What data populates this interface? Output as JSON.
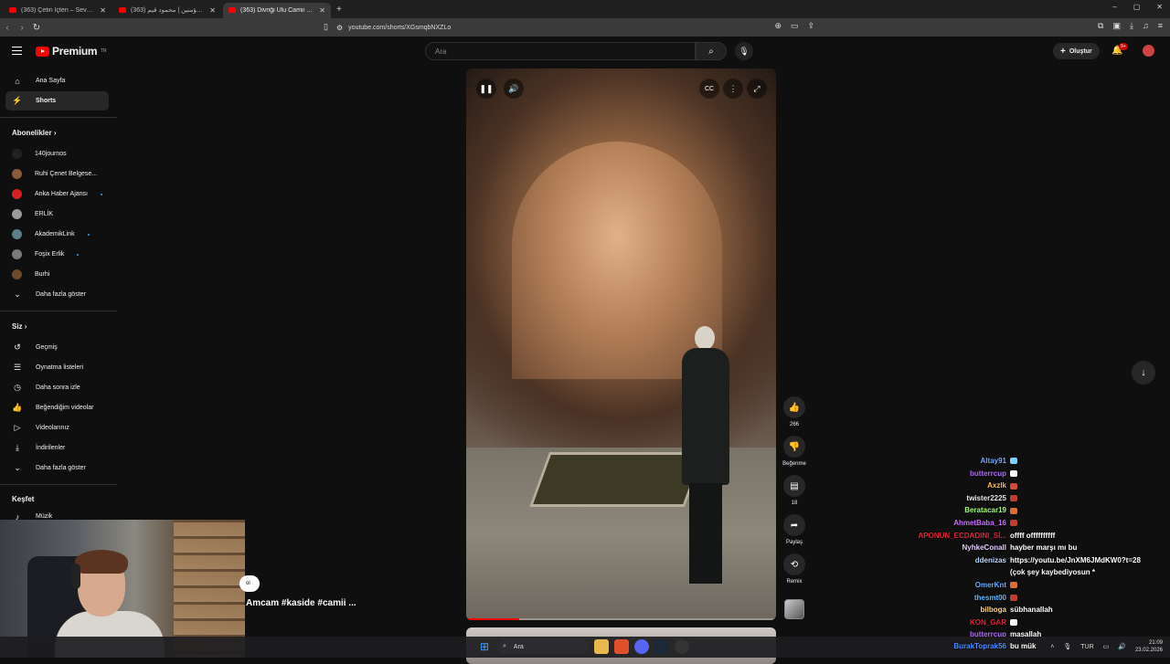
{
  "browser": {
    "tabs": [
      {
        "label": "(363) Çetin İçten – Sevda Değil | Orgi...",
        "active": false
      },
      {
        "label": "ذكر أمير المؤمنين | محمود قيم (363) ...",
        "active": false
      },
      {
        "label": "(363) Divriği Ulu Camii Fehmi...",
        "active": true
      }
    ],
    "new_tab": "+",
    "url": "youtube.com/shorts/XGsmqbNXZLo"
  },
  "youtube": {
    "logo_text": "Premium",
    "logo_sup": "TR",
    "search_placeholder": "Ara",
    "create_label": "Oluştur",
    "notif_badge": "9+"
  },
  "sidebar": {
    "main": [
      {
        "label": "Ana Sayfa",
        "icon": "home-icon",
        "active": false
      },
      {
        "label": "Shorts",
        "icon": "shorts-icon",
        "active": true
      }
    ],
    "subs_heading": "Abonelikler",
    "subs": [
      {
        "label": "140journos",
        "color": "#222222",
        "dot": false
      },
      {
        "label": "Ruhi Çenet Belgese...",
        "color": "#8a5a3a",
        "dot": false
      },
      {
        "label": "Anka Haber Ajansı",
        "color": "#d22222",
        "dot": true
      },
      {
        "label": "ERLİK",
        "color": "#9a9a9a",
        "dot": false
      },
      {
        "label": "AkademikLink",
        "color": "#5d7f8a",
        "dot": true
      },
      {
        "label": "Foşix Erlik",
        "color": "#7a7a7a",
        "dot": true
      },
      {
        "label": "Burhi",
        "color": "#6b4a2a",
        "dot": false
      }
    ],
    "subs_more": "Daha fazla göster",
    "you_heading": "Siz",
    "you": [
      {
        "label": "Geçmiş",
        "icon": "history-icon"
      },
      {
        "label": "Oynatma listeleri",
        "icon": "playlist-icon"
      },
      {
        "label": "Daha sonra izle",
        "icon": "clock-icon"
      },
      {
        "label": "Beğendiğim videolar",
        "icon": "like-icon"
      },
      {
        "label": "Videolarınız",
        "icon": "video-icon"
      },
      {
        "label": "İndirilenler",
        "icon": "download-icon"
      }
    ],
    "you_more": "Daha fazla göster",
    "explore_heading": "Keşfet",
    "explore": [
      {
        "label": "Müzik",
        "icon": "music-icon"
      }
    ]
  },
  "short": {
    "title": "Amcam #kaside #camii ...",
    "channel_badge": "ol",
    "progress": 0.17,
    "actions": {
      "like_count": "266",
      "dislike_label": "Beğenme",
      "comment_count": "18",
      "share_label": "Paylaş",
      "remix_label": "Remix"
    }
  },
  "chat": [
    {
      "name": "Altay91",
      "color": "#7aa7ff",
      "msg": ""
    },
    {
      "name": "butterrcup",
      "color": "#b06bff",
      "msg": ""
    },
    {
      "name": "Axzlk",
      "color": "#ffb84a",
      "msg": ""
    },
    {
      "name": "twister2225",
      "color": "#e8e8e8",
      "msg": ""
    },
    {
      "name": "Beratacar19",
      "color": "#9dff6a",
      "msg": ""
    },
    {
      "name": "AhmetBaba_16",
      "color": "#c770ff",
      "msg": ""
    },
    {
      "name": "APONUN_ECDADINI_Sİ...",
      "color": "#e0243a",
      "msg": "offff offffffffff"
    },
    {
      "name": "NyhkeConall",
      "color": "#e3c9ff",
      "msg": "hayber marşı mı bu"
    },
    {
      "name": "ddenizas",
      "color": "#b8d6ff",
      "msg": "https://youtu.be/JnXM6JMdKW0?t=28"
    },
    {
      "name": "",
      "color": "#ffffff",
      "msg": "(çok şey kaybediyosun *"
    },
    {
      "name": "OmerKnt",
      "color": "#6aa9ff",
      "msg": ""
    },
    {
      "name": "thesmt00",
      "color": "#5fb8ff",
      "msg": ""
    },
    {
      "name": "bilboga",
      "color": "#ffd67a",
      "msg": "sübhanallah"
    },
    {
      "name": "KON_GAR",
      "color": "#e0243a",
      "msg": ""
    },
    {
      "name": "butterrcup",
      "color": "#b06bff",
      "msg": "maşallah"
    },
    {
      "name": "BurakToprak56",
      "color": "#4a8cff",
      "msg": "bu mük"
    }
  ],
  "taskbar": {
    "search_placeholder": "Ara",
    "lang": "TUR",
    "time": "21:09",
    "date": "23.02.2026"
  }
}
